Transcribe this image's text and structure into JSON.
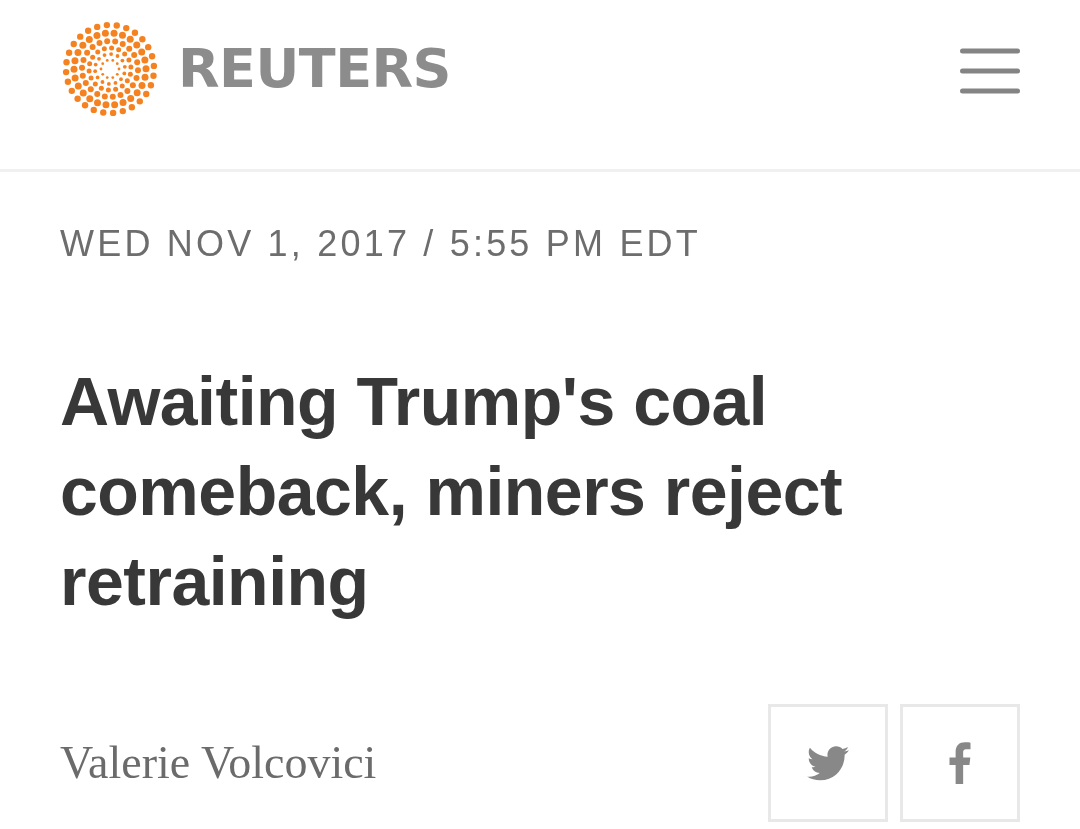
{
  "header": {
    "logo_text": "REUTERS"
  },
  "article": {
    "dateline": "WED NOV 1, 2017 / 5:55 PM EDT",
    "headline": "Awaiting Trump's coal comeback, miners reject retraining",
    "byline": "Valerie Volcovici"
  },
  "share_buttons": [
    {
      "kind": "twitter"
    },
    {
      "kind": "facebook"
    }
  ]
}
